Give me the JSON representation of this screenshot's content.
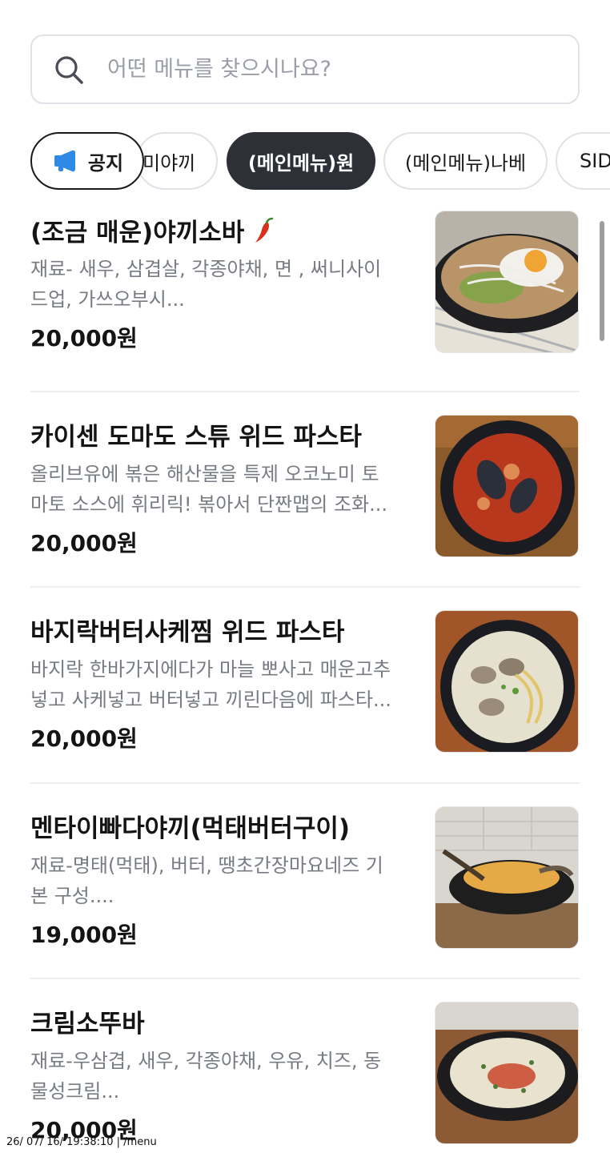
{
  "search": {
    "placeholder": "어떤 메뉴를 찾으시나요?"
  },
  "tabs": {
    "notice": "공지",
    "partial_prev": "미야끼",
    "active": "(메인메뉴)원",
    "next": "(메인메뉴)나베",
    "partial_next": "SID"
  },
  "items": [
    {
      "title": "(조금 매운)야끼소바",
      "desc_line1": "재료- 새우, 삼겹살, 각종야채, 면 , 써니사이",
      "desc_line2": "드업, 가쓰오부시...",
      "price": "20,000원"
    },
    {
      "title": "카이센 도마도 스튜 위드 파스타",
      "desc_line1": "올리브유에 볶은 해산물을 특제 오코노미 토",
      "desc_line2": "마토 소스에 휘리릭! 볶아서 단짠맵의 조화...",
      "price": "20,000원"
    },
    {
      "title": "바지락버터사케찜 위드 파스타",
      "desc_line1": "바지락 한바가지에다가 마늘 뽀사고 매운고추",
      "desc_line2": "넣고 사케넣고 버터넣고 끼린다음에 파스타...",
      "price": "20,000원"
    },
    {
      "title": "멘타이빠다야끼(먹태버터구이)",
      "desc_line1": "재료-명태(먹태), 버터, 땡초간장마요네즈 기",
      "desc_line2": "본 구성....",
      "price": "19,000원"
    },
    {
      "title": "크림소뚜바",
      "desc_line1": "재료-우삼겹, 새우, 각종야채, 우유, 치즈, 동",
      "desc_line2": "물성크림...",
      "price": "20,000원"
    }
  ],
  "footer": {
    "text": "26/ 07/ 16/ 19:38:10 | /menu"
  },
  "colors": {
    "active_tab": "#2d3037",
    "border": "#dfe2e7",
    "desc": "#777b82",
    "chili": "#d8321e",
    "notice_icon": "#2e8ae6"
  },
  "icons": {
    "search": "search-icon",
    "notice": "megaphone-icon",
    "chili": "chili-pepper-icon"
  }
}
